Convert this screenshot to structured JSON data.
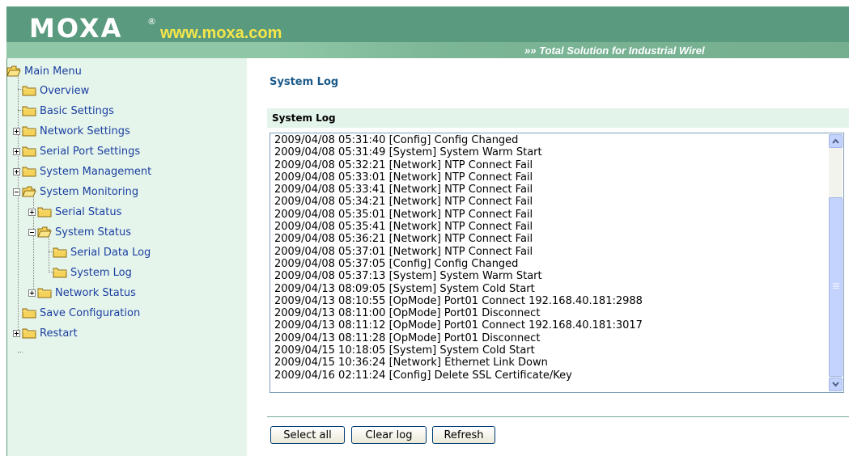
{
  "header": {
    "logo_text": "MOXA",
    "logo_registered": "®",
    "site_url": "www.moxa.com",
    "tagline": "»» Total Solution for Industrial Wirel"
  },
  "sidebar": {
    "items": [
      {
        "label": "Main Menu",
        "icon": "open-folder-icon"
      },
      {
        "label": "Overview",
        "icon": "folder-icon"
      },
      {
        "label": "Basic Settings",
        "icon": "folder-icon"
      },
      {
        "label": "Network Settings",
        "icon": "folder-icon",
        "expander": "plus"
      },
      {
        "label": "Serial Port Settings",
        "icon": "folder-icon",
        "expander": "plus"
      },
      {
        "label": "System Management",
        "icon": "folder-icon",
        "expander": "plus"
      },
      {
        "label": "System Monitoring",
        "icon": "open-folder-icon",
        "expander": "minus"
      },
      {
        "label": "Serial Status",
        "icon": "folder-icon",
        "expander": "plus"
      },
      {
        "label": "System Status",
        "icon": "open-folder-icon",
        "expander": "minus"
      },
      {
        "label": "Serial Data Log",
        "icon": "folder-icon"
      },
      {
        "label": "System Log",
        "icon": "folder-icon"
      },
      {
        "label": "Network Status",
        "icon": "folder-icon",
        "expander": "plus"
      },
      {
        "label": "Save Configuration",
        "icon": "folder-icon"
      },
      {
        "label": "Restart",
        "icon": "folder-icon",
        "expander": "plus"
      }
    ]
  },
  "main": {
    "page_title": "System Log",
    "section_title": "System Log",
    "log_lines": [
      "2009/04/08 05:31:40 [Config] Config Changed",
      "2009/04/08 05:31:49 [System] System Warm Start",
      "2009/04/08 05:32:21 [Network] NTP Connect Fail",
      "2009/04/08 05:33:01 [Network] NTP Connect Fail",
      "2009/04/08 05:33:41 [Network] NTP Connect Fail",
      "2009/04/08 05:34:21 [Network] NTP Connect Fail",
      "2009/04/08 05:35:01 [Network] NTP Connect Fail",
      "2009/04/08 05:35:41 [Network] NTP Connect Fail",
      "2009/04/08 05:36:21 [Network] NTP Connect Fail",
      "2009/04/08 05:37:01 [Network] NTP Connect Fail",
      "2009/04/08 05:37:05 [Config] Config Changed",
      "2009/04/08 05:37:13 [System] System Warm Start",
      "2009/04/13 08:09:05 [System] System Cold Start",
      "2009/04/13 08:10:55 [OpMode] Port01 Connect 192.168.40.181:2988",
      "2009/04/13 08:11:00 [OpMode] Port01 Disconnect",
      "2009/04/13 08:11:12 [OpMode] Port01 Connect 192.168.40.181:3017",
      "2009/04/13 08:11:28 [OpMode] Port01 Disconnect",
      "2009/04/15 10:18:05 [System] System Cold Start",
      "2009/04/15 10:36:24 [Network] Ethernet Link Down",
      "2009/04/16 02:11:24 [Config] Delete SSL Certificate/Key"
    ],
    "buttons": {
      "select_all": "Select all",
      "clear_log": "Clear log",
      "refresh": "Refresh"
    }
  },
  "colors": {
    "header_green": "#5a9a7e",
    "header_band": "#8fc7a6",
    "url_yellow": "#f5e64a",
    "sidebar_bg": "#e6f5ec",
    "link_blue": "#1a3fa0",
    "section_bg": "#e3f4ea"
  }
}
